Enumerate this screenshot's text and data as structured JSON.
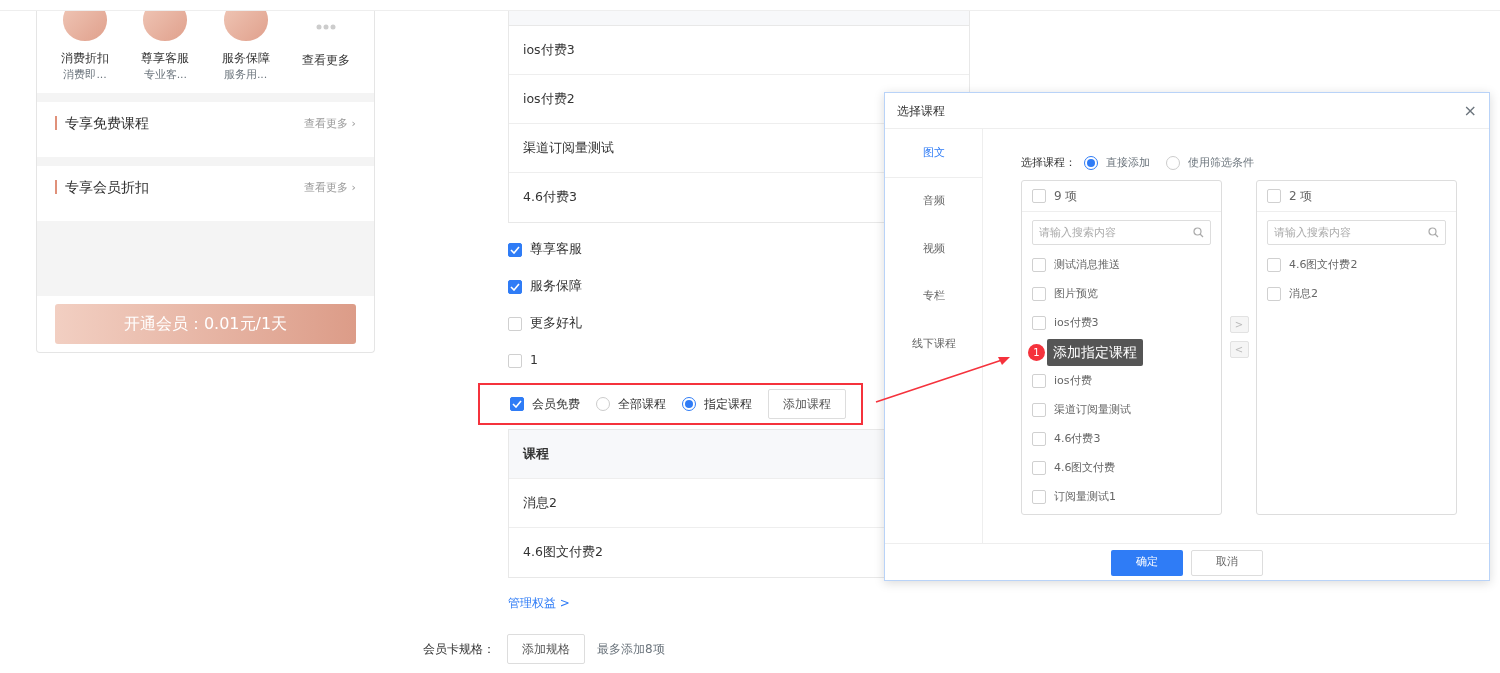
{
  "preview": {
    "benefits": [
      {
        "kind": "benefit",
        "title": "消费折扣",
        "subtitle": "消费即..."
      },
      {
        "kind": "benefit",
        "title": "尊享客服",
        "subtitle": "专业客..."
      },
      {
        "kind": "benefit",
        "title": "服务保障",
        "subtitle": "服务用..."
      },
      {
        "kind": "more",
        "title": "查看更多"
      }
    ],
    "sections": [
      {
        "title": "专享免费课程",
        "more": "查看更多 ›"
      },
      {
        "title": "专享会员折扣",
        "more": "查看更多 ›"
      }
    ],
    "join_button": "开通会员：0.01元/1天"
  },
  "course_table": {
    "rows": [
      "ios付费3",
      "ios付费2",
      "渠道订阅量测试",
      "4.6付费3"
    ]
  },
  "benefit_options": [
    {
      "label": "尊享客服",
      "checked": true
    },
    {
      "label": "服务保障",
      "checked": true
    },
    {
      "label": "更多好礼",
      "checked": false
    },
    {
      "label": "1",
      "checked": false
    }
  ],
  "member_free": {
    "label": "会员免费",
    "checked": true,
    "highlighted": true,
    "scope_options": [
      {
        "label": "全部课程",
        "selected": false
      },
      {
        "label": "指定课程",
        "selected": true
      }
    ],
    "add_button": "添加课程"
  },
  "selected_courses": {
    "columns": [
      "课程"
    ],
    "rows": [
      "消息2",
      "4.6图文付费2"
    ]
  },
  "manage_link": "管理权益 >",
  "card_spec": {
    "label": "会员卡规格：",
    "button": "添加规格",
    "hint": "最多添加8项"
  },
  "dialog": {
    "title": "选择课程",
    "close": "×",
    "tabs": [
      {
        "label": "图文",
        "selected": true
      },
      {
        "label": "音频",
        "selected": false
      },
      {
        "label": "视频",
        "selected": false
      },
      {
        "label": "专栏",
        "selected": false
      },
      {
        "label": "线下课程",
        "selected": false
      }
    ],
    "mode_label": "选择课程：",
    "modes": [
      {
        "label": "直接添加",
        "selected": true
      },
      {
        "label": "使用筛选条件",
        "selected": false
      }
    ],
    "source": {
      "count": "9 项",
      "checked": false,
      "placeholder": "请输入搜索内容",
      "items": [
        {
          "kind": "course",
          "label": "测试消息推送",
          "checked": false
        },
        {
          "kind": "course",
          "label": "图片预览",
          "checked": false
        },
        {
          "kind": "course",
          "label": "ios付费3",
          "checked": false
        },
        {
          "kind": "callout",
          "number": "1",
          "text": "添加指定课程"
        },
        {
          "kind": "course",
          "label": "ios付费",
          "checked": false
        },
        {
          "kind": "course",
          "label": "渠道订阅量测试",
          "checked": false
        },
        {
          "kind": "course",
          "label": "4.6付费3",
          "checked": false
        },
        {
          "kind": "course",
          "label": "4.6图文付费",
          "checked": false
        },
        {
          "kind": "course",
          "label": "订阅量测试1",
          "checked": false
        }
      ]
    },
    "target": {
      "count": "2 项",
      "checked": false,
      "placeholder": "请输入搜索内容",
      "items": [
        {
          "kind": "course",
          "label": "4.6图文付费2",
          "checked": false
        },
        {
          "kind": "course",
          "label": "消息2",
          "checked": false
        }
      ]
    },
    "move_right": ">",
    "move_left": "<",
    "ok": "确定",
    "cancel": "取消"
  }
}
